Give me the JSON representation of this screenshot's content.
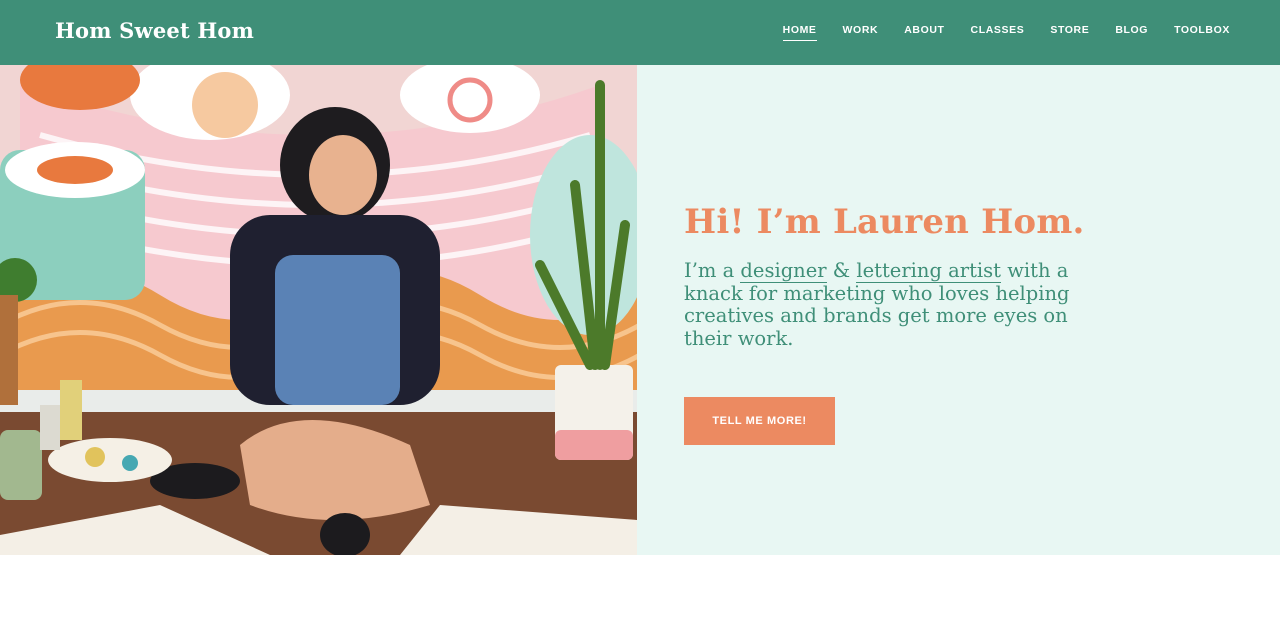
{
  "header": {
    "logo": "Hom Sweet Hom",
    "nav": [
      {
        "label": "HOME",
        "active": true
      },
      {
        "label": "WORK"
      },
      {
        "label": "ABOUT"
      },
      {
        "label": "CLASSES"
      },
      {
        "label": "STORE"
      },
      {
        "label": "BLOG"
      },
      {
        "label": "TOOLBOX"
      }
    ]
  },
  "hero": {
    "headline": "Hi! I’m Lauren Hom.",
    "intro": {
      "part1": "I’m a ",
      "link1": "designer",
      "amp": " & ",
      "link2": "lettering artist",
      "part2": " with a knack for marketing who loves helping creatives and brands get more eyes on their work."
    },
    "cta_label": "TELL ME MORE!"
  },
  "colors": {
    "header_bg": "#3f8f78",
    "accent": "#ec8a61",
    "hero_bg": "#e8f7f3"
  }
}
